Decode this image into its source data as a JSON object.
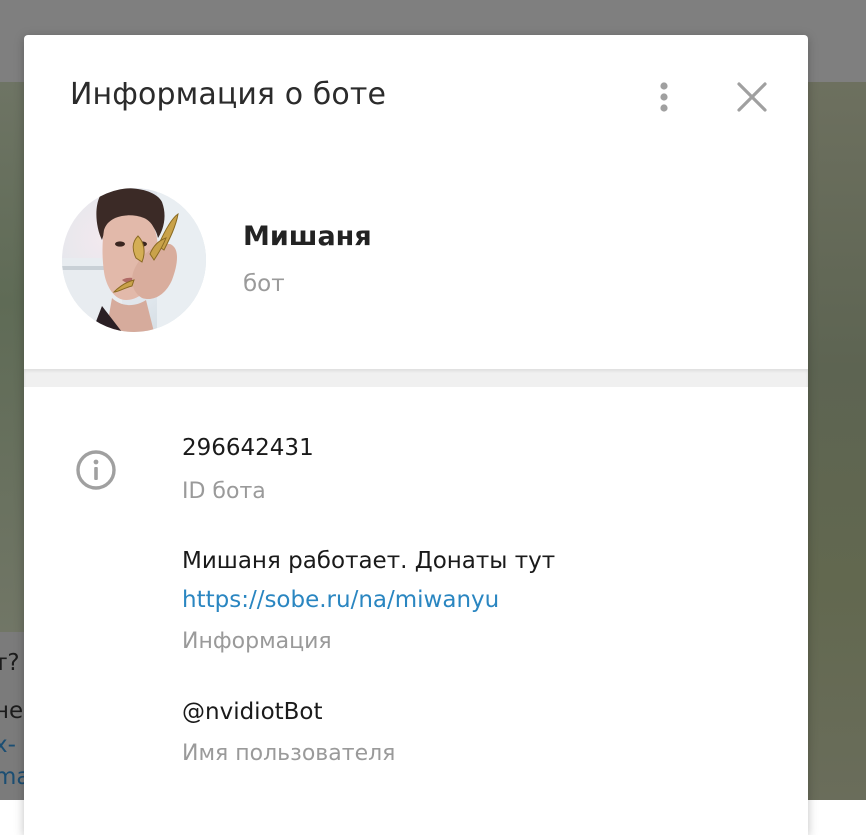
{
  "dialog": {
    "title": "Информация о боте"
  },
  "bot": {
    "name": "Мишаня",
    "status": "бот"
  },
  "info": {
    "id_value": "296642431",
    "id_label": "ID бота",
    "description_text": "Мишаня работает. Донаты тут",
    "description_link": "https://sobe.ru/na/miwanyu",
    "description_label": "Информация",
    "username_value": "@nvidiotBot",
    "username_label": "Имя пользователя"
  },
  "background_chat": {
    "line1": "т?",
    "line2": "не",
    "line3": "х-",
    "line4": "ma"
  },
  "icons": {
    "more": "more-vertical-icon",
    "close": "close-icon",
    "info": "info-circle-icon"
  },
  "colors": {
    "link": "#2a86c1",
    "secondary_text": "#9a9a9a",
    "primary_text": "#1a1a1a",
    "icon": "#a0a0a0"
  }
}
